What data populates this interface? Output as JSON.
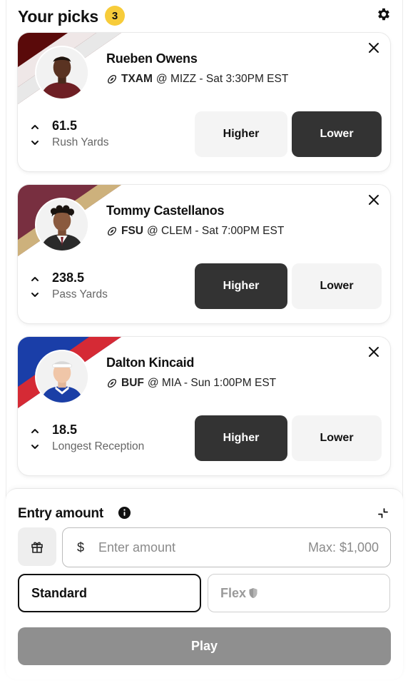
{
  "header": {
    "title": "Your picks",
    "count": "3"
  },
  "picks": [
    {
      "name": "Rueben Owens",
      "team": "TXAM",
      "rest": "@ MIZZ - Sat 3:30PM EST",
      "stat_value": "61.5",
      "stat_label": "Rush Yards",
      "higher_label": "Higher",
      "lower_label": "Lower",
      "selected": "lower",
      "team_colors": [
        "#5a0a0a",
        "#ffffff"
      ]
    },
    {
      "name": "Tommy Castellanos",
      "team": "FSU",
      "rest": "@ CLEM - Sat 7:00PM EST",
      "stat_value": "238.5",
      "stat_label": "Pass Yards",
      "higher_label": "Higher",
      "lower_label": "Lower",
      "selected": "higher",
      "team_colors": [
        "#782f40",
        "#cdb17c"
      ]
    },
    {
      "name": "Dalton Kincaid",
      "team": "BUF",
      "rest": "@ MIA - Sun 1:00PM EST",
      "stat_value": "18.5",
      "stat_label": "Longest Reception",
      "higher_label": "Higher",
      "lower_label": "Lower",
      "selected": "higher",
      "team_colors": [
        "#1a3ea8",
        "#d52a35"
      ]
    }
  ],
  "entry": {
    "title": "Entry amount",
    "currency": "$",
    "placeholder": "Enter amount",
    "max": "Max: $1,000",
    "standard_label": "Standard",
    "flex_label": "Flex",
    "play_label": "Play"
  },
  "colors": {
    "badge": "#f7cc3a",
    "selected_button": "#333333",
    "unselected_button": "#f4f4f4",
    "play_disabled": "#8f8f8f"
  },
  "icons": [
    "gear-icon",
    "football-icon",
    "close-icon",
    "chevron-up-icon",
    "chevron-down-icon",
    "info-icon",
    "collapse-icon",
    "gift-icon",
    "shield-icon"
  ]
}
